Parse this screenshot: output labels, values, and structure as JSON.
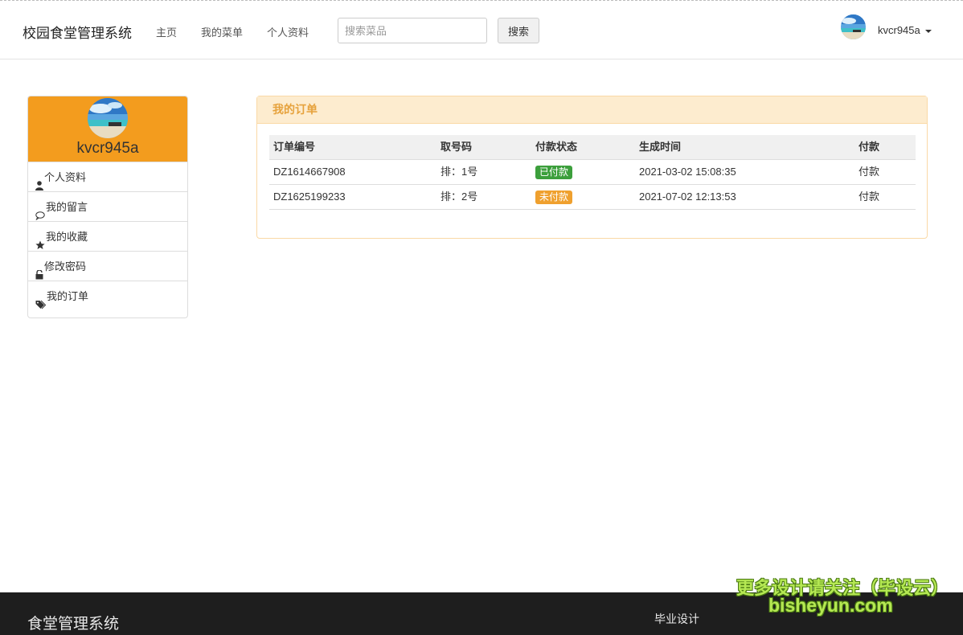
{
  "header": {
    "brand": "校园食堂管理系统",
    "nav": [
      {
        "label": "主页"
      },
      {
        "label": "我的菜单"
      },
      {
        "label": "个人资料"
      }
    ],
    "search": {
      "placeholder": "搜索菜品",
      "value": "",
      "button_label": "搜索"
    },
    "user": {
      "name": "kvcr945a"
    }
  },
  "sidebar": {
    "username": "kvcr945a",
    "items": [
      {
        "label": "个人资料",
        "icon": "user-icon"
      },
      {
        "label": "我的留言",
        "icon": "comment-icon"
      },
      {
        "label": "我的收藏",
        "icon": "star-icon"
      },
      {
        "label": "修改密码",
        "icon": "unlock-icon"
      },
      {
        "label": "我的订单",
        "icon": "tags-icon"
      }
    ]
  },
  "orders": {
    "title": "我的订单",
    "columns": [
      "订单编号",
      "取号码",
      "付款状态",
      "生成时间",
      "付款"
    ],
    "rows": [
      {
        "order_no": "DZ1614667908",
        "ticket": "排：1号",
        "status": "已付款",
        "status_color": "#3c9f3c",
        "created": "2021-03-02 15:08:35",
        "action": "付款"
      },
      {
        "order_no": "DZ1625199233",
        "ticket": "排：2号",
        "status": "未付款",
        "status_color": "#efa02e",
        "created": "2021-07-02 12:13:53",
        "action": "付款"
      }
    ]
  },
  "footer": {
    "title": "食堂管理系统",
    "link": "毕业设计"
  },
  "watermark": {
    "line1": "更多设计请关注（毕设云）",
    "line2": "bisheyun.com"
  },
  "colors": {
    "sidebar_header": "#f39c1e",
    "panel_heading_bg": "#fdeccf",
    "panel_heading_text": "#e6a23c",
    "footer_bg": "#1e1e1e"
  }
}
